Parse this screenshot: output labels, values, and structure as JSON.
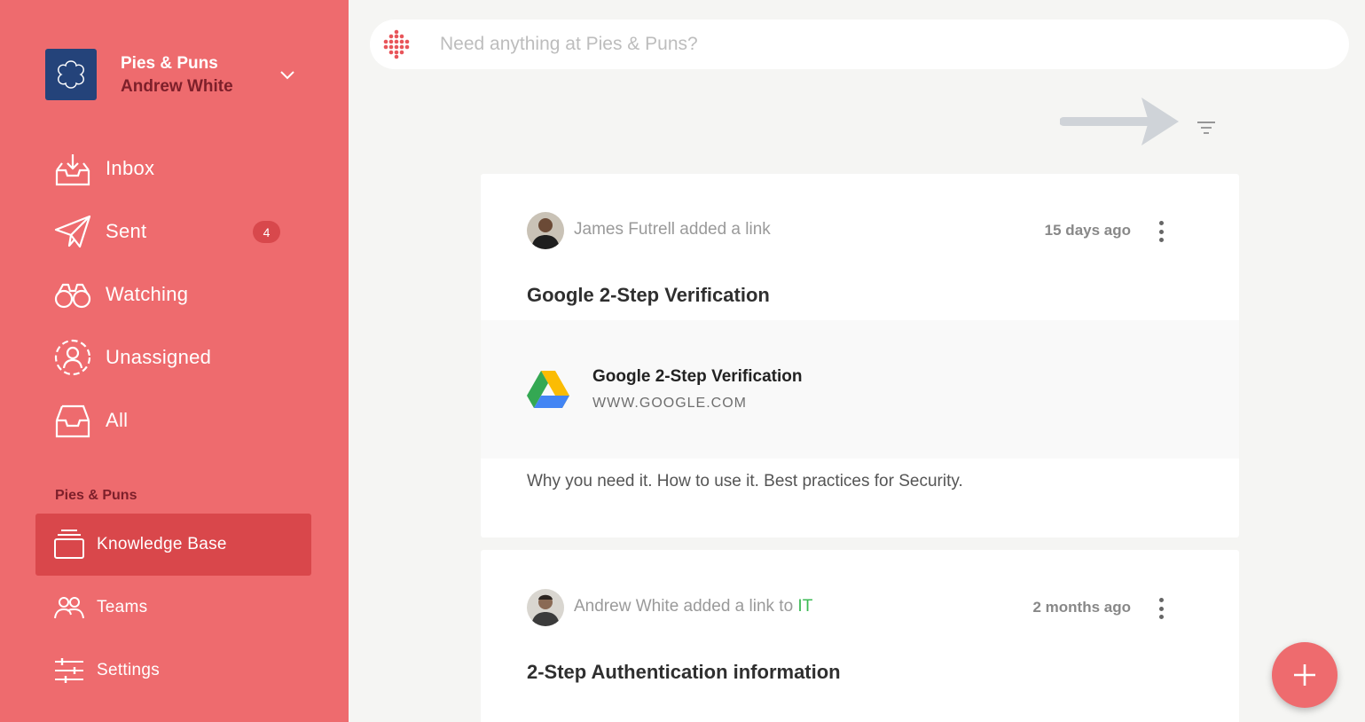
{
  "workspace": {
    "name": "Pies & Puns",
    "user": "Andrew White"
  },
  "nav": {
    "items": [
      {
        "label": "Inbox",
        "icon": "inbox-icon"
      },
      {
        "label": "Sent",
        "icon": "paper-plane-icon",
        "badge": "4"
      },
      {
        "label": "Watching",
        "icon": "binoculars-icon"
      },
      {
        "label": "Unassigned",
        "icon": "unassigned-user-icon"
      },
      {
        "label": "All",
        "icon": "tray-icon"
      }
    ]
  },
  "section": {
    "label": "Pies & Puns",
    "items": [
      {
        "label": "Knowledge Base",
        "icon": "stack-icon",
        "active": true
      },
      {
        "label": "Teams",
        "icon": "team-icon"
      },
      {
        "label": "Settings",
        "icon": "sliders-icon"
      }
    ]
  },
  "search": {
    "placeholder": "Need anything at Pies & Puns?"
  },
  "feed": [
    {
      "actor_text": "James Futrell added a link",
      "time": "15 days ago",
      "title": "Google 2-Step Verification",
      "link": {
        "title": "Google 2-Step Verification",
        "url": "WWW.GOOGLE.COM",
        "icon": "google-drive-icon"
      },
      "description": "Why you need it. How to use it. Best practices for Security."
    },
    {
      "actor_text": "Andrew White added a link to ",
      "team": "IT",
      "time": "2 months ago",
      "title": "2-Step Authentication information"
    }
  ],
  "colors": {
    "sidebar": "#ee6b6e",
    "active": "#d9474b",
    "workspace_logo": "#24437a",
    "team_link": "#3cba54"
  }
}
